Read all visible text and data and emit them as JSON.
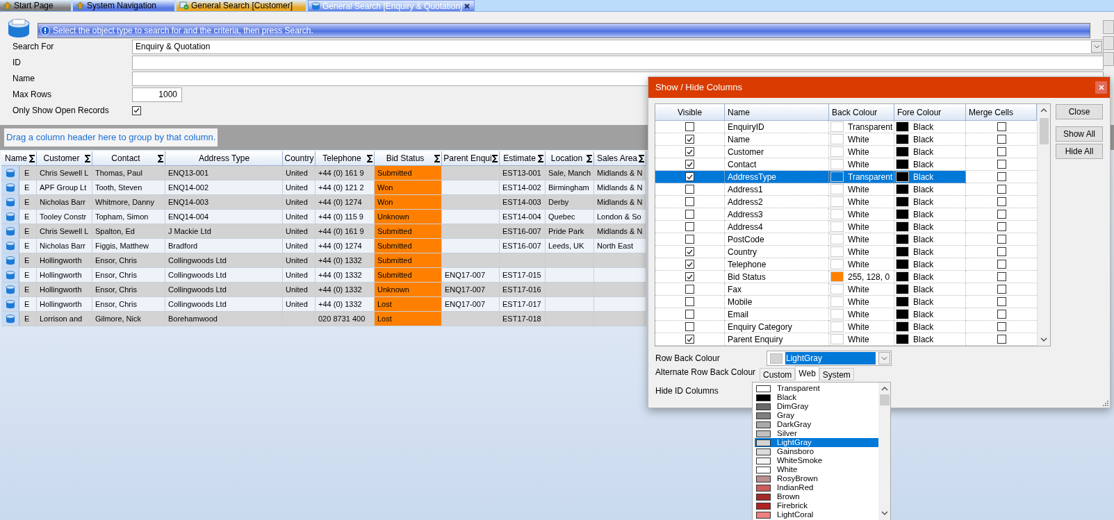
{
  "tabs": [
    {
      "label": "Start Page",
      "color": "#7f7f7f",
      "selected": false
    },
    {
      "label": "System Navigation",
      "color": "#5b7be3",
      "selected": false
    },
    {
      "label": "General Search [Customer]",
      "color": "#e9a825",
      "selected": false
    },
    {
      "label": "General Search [Enquiry & Quotation]",
      "color": "#b8cdf5",
      "selected": true
    }
  ],
  "info_bar": {
    "message": "Select the object type to search for and the criteria, then press Search."
  },
  "form": {
    "fields": [
      {
        "kind": "combo",
        "label": "Search For",
        "value": "Enquiry & Quotation"
      },
      {
        "kind": "text",
        "label": "ID"
      },
      {
        "kind": "text",
        "label": "Name"
      },
      {
        "kind": "number",
        "label": "Max Rows",
        "value": "1000"
      },
      {
        "kind": "checkbox",
        "label": "Only Show Open Records",
        "checked": true
      }
    ]
  },
  "grid": {
    "group_hint": "Drag a column header here to group by that column.",
    "columns": [
      {
        "label": "Name",
        "sum": true
      },
      {
        "label": "Customer",
        "sum": true
      },
      {
        "label": "Contact",
        "sum": true
      },
      {
        "label": "Address Type",
        "sum": false
      },
      {
        "label": "Country",
        "sum": false
      },
      {
        "label": "Telephone",
        "sum": true
      },
      {
        "label": "Bid Status",
        "sum": true,
        "color": "#ff8000"
      },
      {
        "label": "Parent Enqui",
        "sum": true
      },
      {
        "label": "Estimate",
        "sum": true
      },
      {
        "label": "Location",
        "sum": true
      },
      {
        "label": "Sales Area",
        "sum": true
      }
    ],
    "rows": [
      {
        "cells": [
          "E",
          "Chris Sewell L",
          "Thomas, Paul",
          "ENQ13-001",
          "United",
          "+44 (0) 161 9",
          "Submitted",
          null,
          "EST13-001",
          "Sale, Manch",
          "Midlands & N"
        ]
      },
      {
        "cells": [
          "E",
          "APF Group Lt",
          "Tooth, Steven",
          "ENQ14-002",
          "United",
          "+44 (0) 121 2",
          "Won",
          null,
          "EST14-002",
          "Birmingham",
          "Midlands & N"
        ]
      },
      {
        "cells": [
          "E",
          "Nicholas Barr",
          "Whitmore, Danny",
          "ENQ14-003",
          "United",
          "+44 (0) 1274",
          "Won",
          null,
          "EST14-003",
          "Derby",
          "Midlands & N"
        ]
      },
      {
        "cells": [
          "E",
          "Tooley Constr",
          "Topham, Simon",
          "ENQ14-004",
          "United",
          "+44 (0) 115 9",
          "Unknown",
          null,
          "EST14-004",
          "Quebec",
          "London & So"
        ]
      },
      {
        "cells": [
          "E",
          "Chris Sewell L",
          "Spalton, Ed",
          "J Mackie Ltd",
          "United",
          "+44 (0) 161 9",
          "Submitted",
          null,
          "EST16-007",
          "Pride Park",
          "Midlands & N"
        ]
      },
      {
        "cells": [
          "E",
          "Nicholas Barr",
          "Figgis, Matthew",
          "Bradford",
          "United",
          "+44 (0) 1274",
          "Submitted",
          null,
          "EST16-007",
          "Leeds, UK",
          "North East"
        ]
      },
      {
        "cells": [
          "E",
          "Hollingworth",
          "Ensor, Chris",
          "Collingwoods Ltd",
          "United",
          "+44 (0) 1332",
          "Submitted",
          null,
          null,
          null,
          null
        ]
      },
      {
        "cells": [
          "E",
          "Hollingworth",
          "Ensor, Chris",
          "Collingwoods Ltd",
          "United",
          "+44 (0) 1332",
          "Submitted",
          "ENQ17-007",
          "EST17-015",
          null,
          null
        ]
      },
      {
        "cells": [
          "E",
          "Hollingworth",
          "Ensor, Chris",
          "Collingwoods Ltd",
          "United",
          "+44 (0) 1332",
          "Unknown",
          "ENQ17-007",
          "EST17-016",
          null,
          null
        ]
      },
      {
        "cells": [
          "E",
          "Hollingworth",
          "Ensor, Chris",
          "Collingwoods Ltd",
          "United",
          "+44 (0) 1332",
          "Lost",
          "ENQ17-007",
          "EST17-017",
          null,
          null
        ]
      },
      {
        "cells": [
          "E",
          "Lorrison and",
          "Gilmore, Nick",
          "Borehamwood",
          null,
          "020 8731 400",
          "Lost",
          null,
          "EST17-018",
          null,
          null
        ]
      }
    ]
  },
  "dialog": {
    "title": "Show / Hide Columns",
    "columns": [
      "Visible",
      "Name",
      "Back Colour",
      "Fore Colour",
      "Merge Cells"
    ],
    "rows": [
      {
        "visible": false,
        "name": "EnquiryID",
        "back": "Transparent",
        "fore": "Black",
        "fore_swatch": {
          "color": "#000000"
        },
        "merge": false,
        "selected": false
      },
      {
        "visible": true,
        "name": "Name",
        "back": "White",
        "back_swatch": {
          "color": "#ffffff"
        },
        "fore": "Black",
        "fore_swatch": {
          "color": "#000000"
        },
        "merge": false,
        "selected": false
      },
      {
        "visible": true,
        "name": "Customer",
        "back": "White",
        "back_swatch": {
          "color": "#ffffff"
        },
        "fore": "Black",
        "fore_swatch": {
          "color": "#000000"
        },
        "merge": false,
        "selected": false
      },
      {
        "visible": true,
        "name": "Contact",
        "back": "White",
        "back_swatch": {
          "color": "#ffffff"
        },
        "fore": "Black",
        "fore_swatch": {
          "color": "#000000"
        },
        "merge": false,
        "selected": false
      },
      {
        "visible": true,
        "name": "AddressType",
        "back": "Transparent",
        "fore": "Black",
        "fore_swatch": {
          "color": "#000000"
        },
        "merge": false,
        "selected": true
      },
      {
        "visible": false,
        "name": "Address1",
        "back": "White",
        "back_swatch": {
          "color": "#ffffff"
        },
        "fore": "Black",
        "fore_swatch": {
          "color": "#000000"
        },
        "merge": false,
        "selected": false
      },
      {
        "visible": false,
        "name": "Address2",
        "back": "White",
        "back_swatch": {
          "color": "#ffffff"
        },
        "fore": "Black",
        "fore_swatch": {
          "color": "#000000"
        },
        "merge": false,
        "selected": false
      },
      {
        "visible": false,
        "name": "Address3",
        "back": "White",
        "back_swatch": {
          "color": "#ffffff"
        },
        "fore": "Black",
        "fore_swatch": {
          "color": "#000000"
        },
        "merge": false,
        "selected": false
      },
      {
        "visible": false,
        "name": "Address4",
        "back": "White",
        "back_swatch": {
          "color": "#ffffff"
        },
        "fore": "Black",
        "fore_swatch": {
          "color": "#000000"
        },
        "merge": false,
        "selected": false
      },
      {
        "visible": false,
        "name": "PostCode",
        "back": "White",
        "back_swatch": {
          "color": "#ffffff"
        },
        "fore": "Black",
        "fore_swatch": {
          "color": "#000000"
        },
        "merge": false,
        "selected": false
      },
      {
        "visible": true,
        "name": "Country",
        "back": "White",
        "back_swatch": {
          "color": "#ffffff"
        },
        "fore": "Black",
        "fore_swatch": {
          "color": "#000000"
        },
        "merge": false,
        "selected": false
      },
      {
        "visible": true,
        "name": "Telephone",
        "back": "White",
        "back_swatch": {
          "color": "#ffffff"
        },
        "fore": "Black",
        "fore_swatch": {
          "color": "#000000"
        },
        "merge": false,
        "selected": false
      },
      {
        "visible": true,
        "name": "Bid Status",
        "back": "255, 128, 0",
        "back_swatch": {
          "color": "#ff8000"
        },
        "fore": "Black",
        "fore_swatch": {
          "color": "#000000"
        },
        "merge": false,
        "selected": false
      },
      {
        "visible": false,
        "name": "Fax",
        "back": "White",
        "back_swatch": {
          "color": "#ffffff"
        },
        "fore": "Black",
        "fore_swatch": {
          "color": "#000000"
        },
        "merge": false,
        "selected": false
      },
      {
        "visible": false,
        "name": "Mobile",
        "back": "White",
        "back_swatch": {
          "color": "#ffffff"
        },
        "fore": "Black",
        "fore_swatch": {
          "color": "#000000"
        },
        "merge": false,
        "selected": false
      },
      {
        "visible": false,
        "name": "Email",
        "back": "White",
        "back_swatch": {
          "color": "#ffffff"
        },
        "fore": "Black",
        "fore_swatch": {
          "color": "#000000"
        },
        "merge": false,
        "selected": false
      },
      {
        "visible": false,
        "name": "Enquiry Category",
        "back": "White",
        "back_swatch": {
          "color": "#ffffff"
        },
        "fore": "Black",
        "fore_swatch": {
          "color": "#000000"
        },
        "merge": false,
        "selected": false
      },
      {
        "visible": true,
        "name": "Parent Enquiry",
        "back": "White",
        "back_swatch": {
          "color": "#ffffff"
        },
        "fore": "Black",
        "fore_swatch": {
          "color": "#000000"
        },
        "merge": false,
        "selected": false
      }
    ],
    "buttons": [
      "Close",
      "Show All",
      "Hide All"
    ],
    "row_back": {
      "label": "Row Back Colour",
      "value": "LightGray",
      "color": "#d3d3d3"
    },
    "alt_row_back": {
      "label": "Alternate Row Back Colour"
    },
    "hide_id": {
      "label": "Hide ID Columns"
    },
    "picker_tabs": [
      {
        "label": "Custom",
        "selected": false
      },
      {
        "label": "Web",
        "selected": true
      },
      {
        "label": "System",
        "selected": false
      }
    ],
    "colours": [
      {
        "name": "Transparent",
        "selected": false
      },
      {
        "name": "Black",
        "color": "#000000",
        "selected": false
      },
      {
        "name": "DimGray",
        "color": "#696969",
        "selected": false
      },
      {
        "name": "Gray",
        "color": "#808080",
        "selected": false
      },
      {
        "name": "DarkGray",
        "color": "#a9a9a9",
        "selected": false
      },
      {
        "name": "Silver",
        "color": "#c0c0c0",
        "selected": false
      },
      {
        "name": "LightGray",
        "color": "#d3d3d3",
        "selected": true
      },
      {
        "name": "Gainsboro",
        "color": "#dcdcdc",
        "selected": false
      },
      {
        "name": "WhiteSmoke",
        "color": "#f5f5f5",
        "selected": false
      },
      {
        "name": "White",
        "color": "#ffffff",
        "selected": false
      },
      {
        "name": "RosyBrown",
        "color": "#bc8f8f",
        "selected": false
      },
      {
        "name": "IndianRed",
        "color": "#cd5c5c",
        "selected": false
      },
      {
        "name": "Brown",
        "color": "#a52a2a",
        "selected": false
      },
      {
        "name": "Firebrick",
        "color": "#b22222",
        "selected": false
      },
      {
        "name": "LightCoral",
        "color": "#f08080",
        "selected": false
      }
    ]
  }
}
